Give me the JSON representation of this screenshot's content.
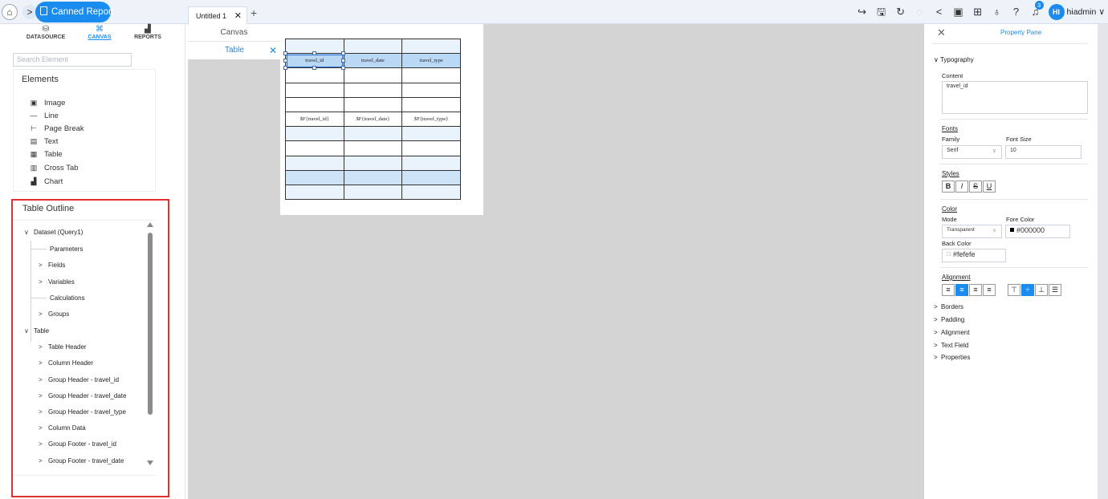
{
  "topbar": {
    "home_icon": "home-icon",
    "breadcrumb_arrow": ">",
    "report_button": "Canned Report",
    "doc_tab": "Untitled 1",
    "doc_tab_close": "✕",
    "add_tab": "+",
    "notification_count": "3",
    "user_initials": "HI",
    "user_name": "hiadmin",
    "user_caret": "∨"
  },
  "left_tabs": [
    {
      "label": "DATASOURCE",
      "glyph": "⛁"
    },
    {
      "label": "CANVAS",
      "glyph": "⌘"
    },
    {
      "label": "REPORTS",
      "glyph": "▟"
    }
  ],
  "search": {
    "placeholder": "Search Element"
  },
  "elements": {
    "title": "Elements",
    "items": [
      {
        "label": "Image",
        "icon": "▣"
      },
      {
        "label": "Line",
        "icon": "—"
      },
      {
        "label": "Page Break",
        "icon": "⊢"
      },
      {
        "label": "Text",
        "icon": "▤"
      },
      {
        "label": "Table",
        "icon": "▦"
      },
      {
        "label": "Cross Tab",
        "icon": "▥"
      },
      {
        "label": "Chart",
        "icon": "▟"
      }
    ]
  },
  "outline": {
    "title": "Table Outline",
    "items": [
      {
        "label": "Dataset (Query1)",
        "chev": "∨"
      },
      {
        "label": "Parameters",
        "chev": ""
      },
      {
        "label": "Fields",
        "chev": ">"
      },
      {
        "label": "Variables",
        "chev": ">"
      },
      {
        "label": "Calculations",
        "chev": ""
      },
      {
        "label": "Groups",
        "chev": ">"
      },
      {
        "label": "Table",
        "chev": "∨"
      },
      {
        "label": "Table Header",
        "chev": ">"
      },
      {
        "label": "Column Header",
        "chev": ">"
      },
      {
        "label": "Group Header - travel_id",
        "chev": ">"
      },
      {
        "label": "Group Header - travel_date",
        "chev": ">"
      },
      {
        "label": "Group Header - travel_type",
        "chev": ">"
      },
      {
        "label": "Column Data",
        "chev": ">"
      },
      {
        "label": "Group Footer - travel_id",
        "chev": ">"
      },
      {
        "label": "Group Footer - travel_date",
        "chev": ">"
      }
    ]
  },
  "structure": {
    "canvas": "Canvas",
    "table": "Table",
    "close": "✕"
  },
  "table_grid": {
    "rows": [
      {
        "cells": [
          "",
          "",
          ""
        ],
        "style": "alt"
      },
      {
        "cells": [
          "travel_id",
          "travel_date",
          "travel_type"
        ],
        "style": "sel"
      },
      {
        "cells": [
          "",
          "",
          ""
        ],
        "style": ""
      },
      {
        "cells": [
          "",
          "",
          ""
        ],
        "style": ""
      },
      {
        "cells": [
          "",
          "",
          ""
        ],
        "style": ""
      },
      {
        "cells": [
          "$F{travel_id}",
          "$F{travel_date}",
          "$F{travel_type}"
        ],
        "style": ""
      },
      {
        "cells": [
          "",
          "",
          ""
        ],
        "style": "alt"
      },
      {
        "cells": [
          "",
          "",
          ""
        ],
        "style": ""
      },
      {
        "cells": [
          "",
          "",
          ""
        ],
        "style": "alt"
      },
      {
        "cells": [
          "",
          "",
          ""
        ],
        "style": "hdr"
      },
      {
        "cells": [
          "",
          "",
          ""
        ],
        "style": "alt"
      }
    ]
  },
  "property_pane": {
    "title": "Property Pane",
    "close": "✕",
    "typography": "Typography",
    "content_label": "Content",
    "content_value": "travel_id",
    "fonts_label": "Fonts",
    "family_label": "Family",
    "family_value": "Serif",
    "font_size_label": "Font Size",
    "font_size_value": "10",
    "styles_label": "Styles",
    "style_buttons": [
      "B",
      "I",
      "S",
      "U"
    ],
    "color_label": "Color",
    "mode_label": "Mode",
    "mode_value": "Transparent",
    "fore_color_label": "Fore Color",
    "fore_color_value": "#000000",
    "back_color_label": "Back Color",
    "back_color_value": "#fefefe",
    "alignment_label": "Alignment",
    "accordion": [
      "Borders",
      "Padding",
      "Alignment",
      "Text Field",
      "Properties"
    ],
    "accent": "#1a8cf0"
  }
}
